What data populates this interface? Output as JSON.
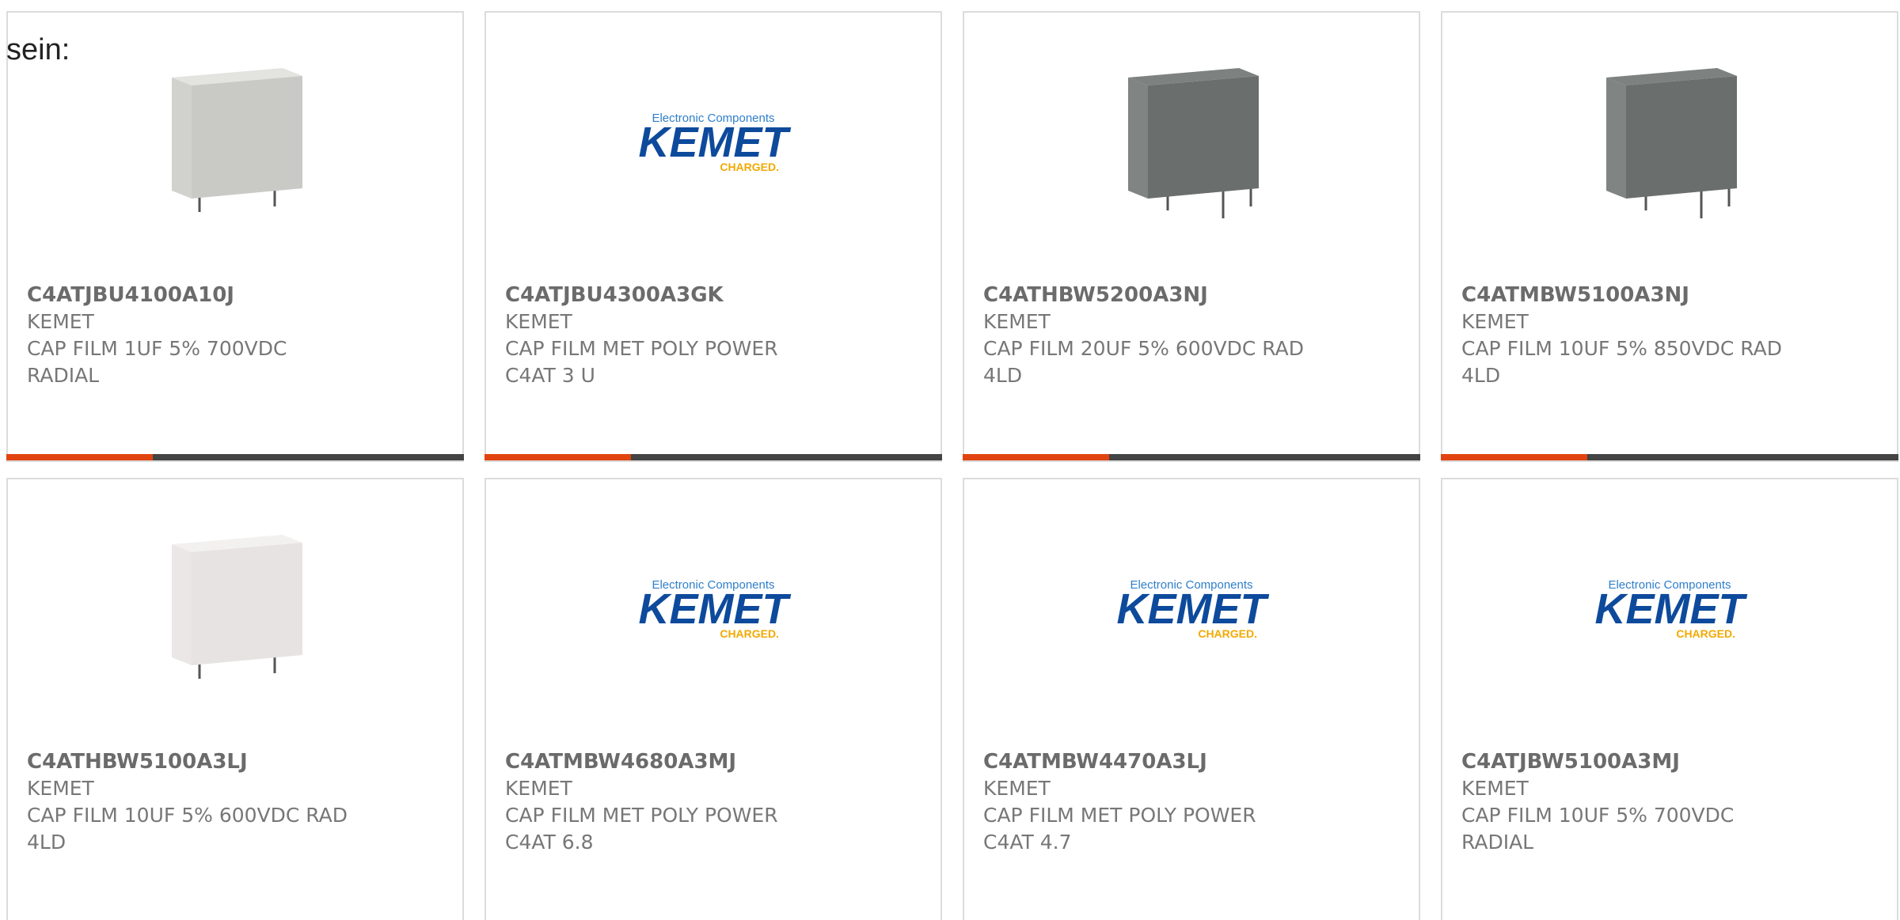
{
  "intro": {
    "text": "sein:"
  },
  "products": [
    {
      "part_number": "C4ATJBU4100A10J",
      "manufacturer": "KEMET",
      "desc_line1": "CAP FILM 1UF 5% 700VDC",
      "desc_line2": "RADIAL",
      "image": "capacitor-light-gray",
      "color": "#c9cac6",
      "shade": "#e3e4e0",
      "progress": 0.32
    },
    {
      "part_number": "C4ATJBU4300A3GK",
      "manufacturer": "KEMET",
      "desc_line1": "CAP FILM MET POLY POWER",
      "desc_line2": "C4AT 3 U",
      "image": "kemet-logo",
      "progress": 0.32
    },
    {
      "part_number": "C4ATHBW5200A3NJ",
      "manufacturer": "KEMET",
      "desc_line1": "CAP FILM 20UF 5% 600VDC RAD",
      "desc_line2": "4LD",
      "image": "capacitor-dark-gray",
      "color": "#6a6f6d",
      "shade": "#7d8280",
      "progress": 0.32
    },
    {
      "part_number": "C4ATMBW5100A3NJ",
      "manufacturer": "KEMET",
      "desc_line1": "CAP FILM 10UF 5% 850VDC RAD",
      "desc_line2": "4LD",
      "image": "capacitor-dark-gray",
      "color": "#6a6f6d",
      "shade": "#7d8280",
      "progress": 0.32
    },
    {
      "part_number": "C4ATHBW5100A3LJ",
      "manufacturer": "KEMET",
      "desc_line1": "CAP FILM 10UF 5% 600VDC RAD",
      "desc_line2": "4LD",
      "image": "capacitor-white",
      "color": "#e6e3e2",
      "shade": "#f3f1f0"
    },
    {
      "part_number": "C4ATMBW4680A3MJ",
      "manufacturer": "KEMET",
      "desc_line1": "CAP FILM MET POLY POWER",
      "desc_line2": "C4AT 6.8",
      "image": "kemet-logo"
    },
    {
      "part_number": "C4ATMBW4470A3LJ",
      "manufacturer": "KEMET",
      "desc_line1": "CAP FILM MET POLY POWER",
      "desc_line2": "C4AT 4.7",
      "image": "kemet-logo"
    },
    {
      "part_number": "C4ATJBW5100A3MJ",
      "manufacturer": "KEMET",
      "desc_line1": "CAP FILM 10UF 5% 700VDC",
      "desc_line2": "RADIAL",
      "image": "kemet-logo"
    }
  ],
  "logo": {
    "tagline": "Electronic Components",
    "brand": "KEMET",
    "slogan": "CHARGED.",
    "brand_color": "#0d4a9c",
    "tagline_color": "#2f7fc9",
    "slogan_color": "#f2a900"
  },
  "colors": {
    "accent": "#e14410",
    "bar": "#444444",
    "border": "#dcdcdc",
    "text": "#777777"
  }
}
